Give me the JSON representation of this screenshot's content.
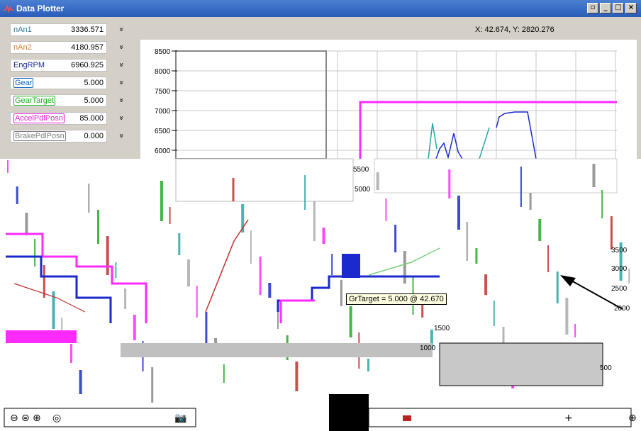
{
  "window": {
    "title": "Data Plotter",
    "controls": [
      "restore-down",
      "minimize",
      "maximize",
      "close"
    ]
  },
  "channels": [
    {
      "name": "nAn1",
      "value": "3336.571",
      "color": "#2a7a9a",
      "boxed": false
    },
    {
      "name": "nAn2",
      "value": "4180.957",
      "color": "#e07a30",
      "boxed": false
    },
    {
      "name": "EngRPM",
      "value": "6960.925",
      "color": "#1a2a8a",
      "boxed": false
    },
    {
      "name": "Gear",
      "value": "5.000",
      "color": "#1a6ac0",
      "boxed": true
    },
    {
      "name": "GearTarget",
      "value": "5.000",
      "color": "#22aa22",
      "boxed": true
    },
    {
      "name": "AccelPdlPosn",
      "value": "85.000",
      "color": "#e020d0",
      "boxed": true
    },
    {
      "name": "BrakePdlPosn",
      "value": "0.000",
      "color": "#808080",
      "boxed": true
    }
  ],
  "cursor_readout": "X: 42.674, Y: 2820.276",
  "y_ticks": [
    "8500",
    "8000",
    "7500",
    "7000",
    "6500",
    "6000",
    "5500",
    "5000"
  ],
  "fragment_ticks": [
    "3500",
    "3000",
    "2500",
    "2000",
    "1500",
    "1000",
    "500"
  ],
  "tooltip": "GrTarget = 5.000 @ 42.670",
  "colors": {
    "titlebar": "#2a5cb8",
    "accel": "#ff2aff",
    "gear": "#1a2acc",
    "teal": "#2aa5a5",
    "grid": "#c8c8c8"
  },
  "toolbar_icons": [
    "zoom-out-icon",
    "zoom-fit-icon",
    "zoom-in-icon",
    "camera-icon"
  ]
}
